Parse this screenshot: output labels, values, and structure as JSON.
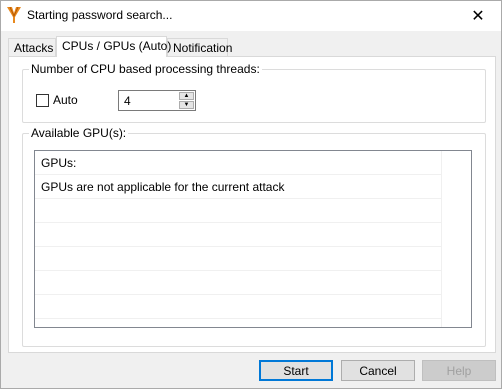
{
  "window": {
    "title": "Starting password search...",
    "close_glyph": "✕"
  },
  "tabs": [
    {
      "label": "Attacks",
      "active": false
    },
    {
      "label": "CPUs / GPUs (Auto)",
      "active": true
    },
    {
      "label": "Notification",
      "active": false
    }
  ],
  "cpu": {
    "group_title": "Number of CPU based processing threads:",
    "auto_label": "Auto",
    "auto_checked": false,
    "threads_value": "4"
  },
  "gpu": {
    "group_title": "Available GPU(s):",
    "list_items": [
      "GPUs:",
      "GPUs are not applicable for the current attack"
    ]
  },
  "buttons": {
    "start": "Start",
    "cancel": "Cancel",
    "help": "Help"
  },
  "icons": {
    "app": "app-logo-icon",
    "close": "close-icon",
    "spin_up": "spin-up-icon",
    "spin_down": "spin-down-icon"
  },
  "colors": {
    "accent": "#0078d7",
    "logo": "#e8891e"
  }
}
